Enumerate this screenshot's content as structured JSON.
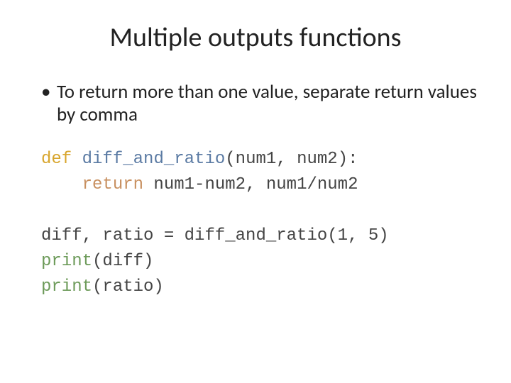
{
  "title": "Multiple outputs functions",
  "bullet": "To return more than one value, separate return values by comma",
  "code": {
    "l1": {
      "kw": "def",
      "fn": " diff_and_ratio",
      "rest": "(num1, num2):"
    },
    "l2": {
      "indent": "    ",
      "kw": "return",
      "rest": " num1-num2, num1/num2"
    },
    "l3": "diff, ratio = diff_and_ratio(1, 5)",
    "l4": {
      "fn": "print",
      "rest": "(diff)"
    },
    "l5": {
      "fn": "print",
      "rest": "(ratio)"
    }
  }
}
